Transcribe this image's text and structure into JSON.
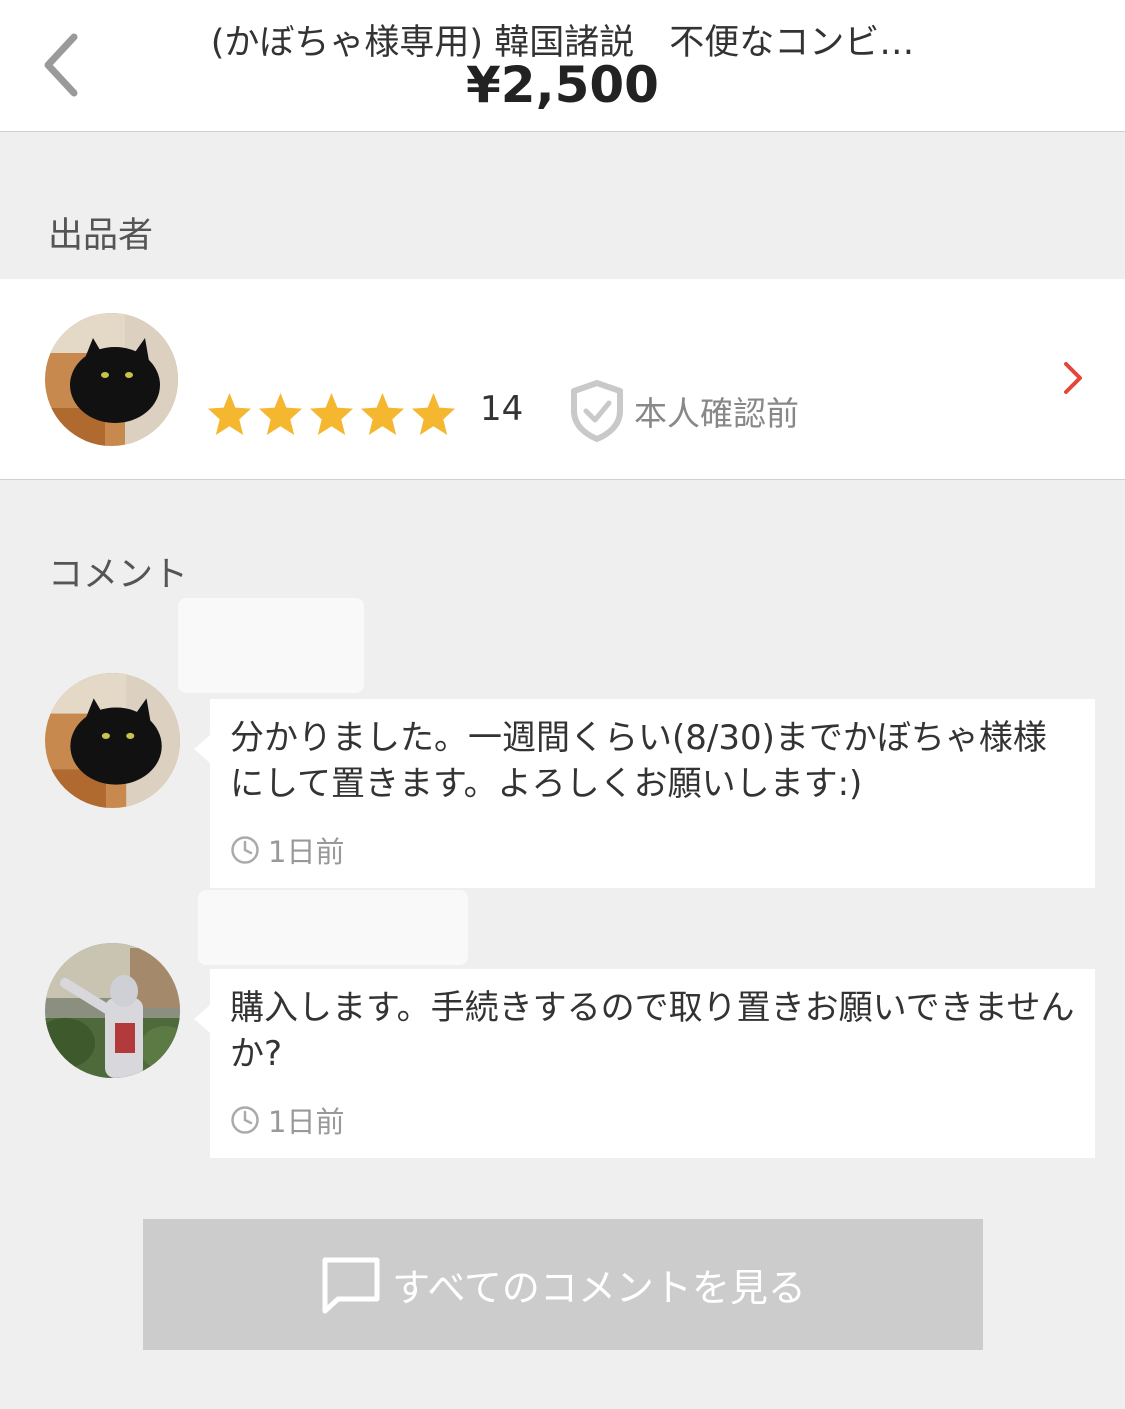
{
  "header": {
    "title": "(かぼちゃ様専用) 韓国諸説　不便なコンビ…",
    "price": "¥2,500"
  },
  "seller_section": {
    "heading": "出品者",
    "rating_stars": 5,
    "rating_count": "14",
    "verification": "本人確認前"
  },
  "comments_section": {
    "heading": "コメント",
    "comments": [
      {
        "text": "分かりました。一週間くらい(8/30)までかぼちゃ様様にして置きます。よろしくお願いします:)",
        "time": "1日前"
      },
      {
        "text": "購入します。手続きするので取り置きお願いできませんか?",
        "time": "1日前"
      }
    ],
    "all_comments_label": "すべてのコメントを見る"
  },
  "colors": {
    "star": "#f5b630",
    "chevron": "#e2483a",
    "button_bg": "#cccccc"
  }
}
